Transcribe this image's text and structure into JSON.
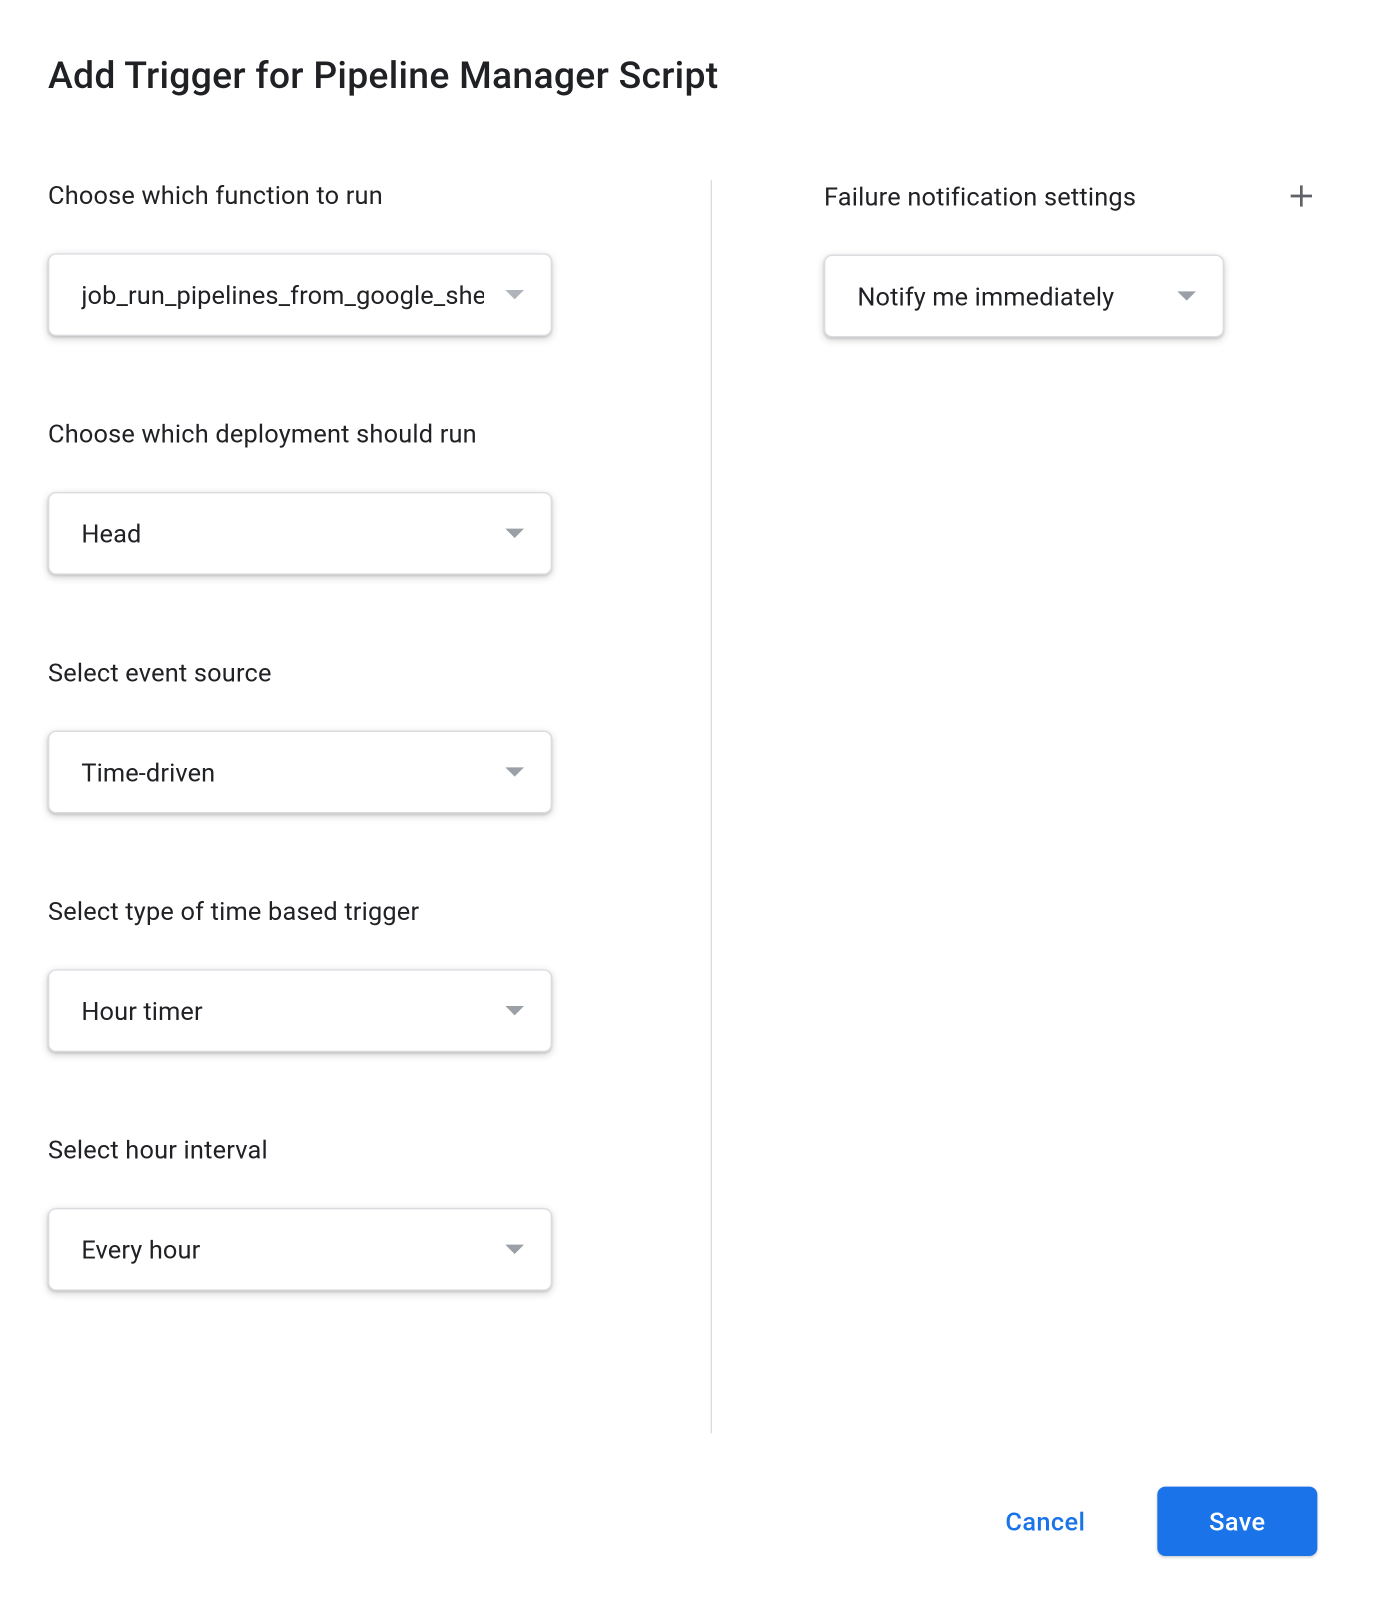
{
  "dialog": {
    "title": "Add Trigger for Pipeline Manager Script"
  },
  "left": {
    "function_label": "Choose which function to run",
    "function_value": "job_run_pipelines_from_google_sheet",
    "deployment_label": "Choose which deployment should run",
    "deployment_value": "Head",
    "event_source_label": "Select event source",
    "event_source_value": "Time-driven",
    "trigger_type_label": "Select type of time based trigger",
    "trigger_type_value": "Hour timer",
    "interval_label": "Select hour interval",
    "interval_value": "Every hour"
  },
  "right": {
    "failure_label": "Failure notification settings",
    "failure_value": "Notify me immediately"
  },
  "footer": {
    "cancel": "Cancel",
    "save": "Save"
  }
}
